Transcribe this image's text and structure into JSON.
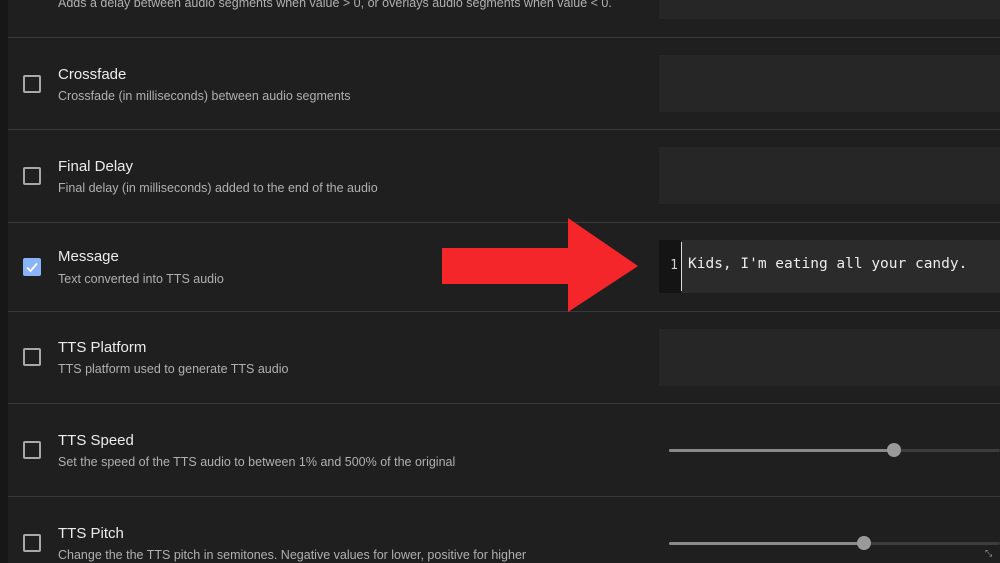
{
  "rows": [
    {
      "label": "",
      "description": "Adds a delay between audio segments when value > 0, or overlays audio segments when value < 0.",
      "checked": false
    },
    {
      "label": "Crossfade",
      "description": "Crossfade (in milliseconds) between audio segments",
      "checked": false
    },
    {
      "label": "Final Delay",
      "description": "Final delay (in milliseconds) added to the end of the audio",
      "checked": false
    },
    {
      "label": "Message",
      "description": "Text converted into TTS audio",
      "checked": true
    },
    {
      "label": "TTS Platform",
      "description": "TTS platform used to generate TTS audio",
      "checked": false
    },
    {
      "label": "TTS Speed",
      "description": "Set the speed of the TTS audio to between 1% and 500% of the original",
      "checked": false
    },
    {
      "label": "TTS Pitch",
      "description": "Change the the TTS pitch in semitones. Negative values for lower, positive for higher",
      "checked": false
    }
  ],
  "message_editor": {
    "line_number": "1",
    "text": "Kids, I'm eating all your candy."
  },
  "sliders": {
    "tts_speed": 0.68,
    "tts_pitch": 0.59
  },
  "colors": {
    "arrow": "#f5262a",
    "checkbox_checked": "#8ab4f8",
    "background": "#1f1f1f"
  },
  "icons": {
    "checkmark": "check-icon",
    "arrow": "right-arrow-icon",
    "corner": "resize-icon"
  }
}
